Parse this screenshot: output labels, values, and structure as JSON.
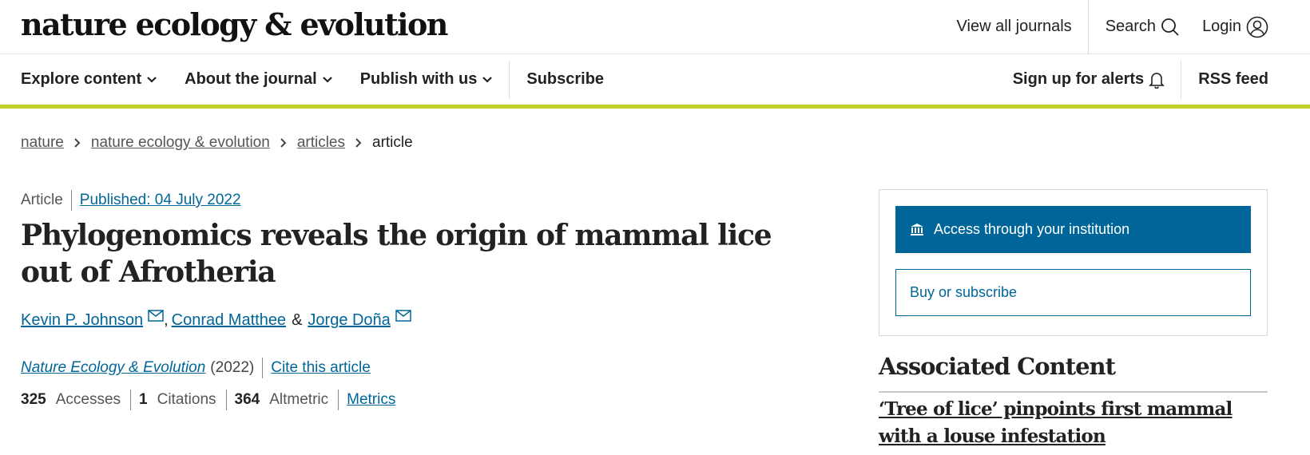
{
  "header": {
    "logo": "nature ecology & evolution",
    "view_all_journals": "View all journals",
    "search_label": "Search",
    "login_label": "Login"
  },
  "nav": {
    "explore": "Explore content",
    "about": "About the journal",
    "publish": "Publish with us",
    "subscribe": "Subscribe",
    "alerts": "Sign up for alerts",
    "rss": "RSS feed"
  },
  "breadcrumb": [
    "nature",
    "nature ecology & evolution",
    "articles",
    "article"
  ],
  "article": {
    "type": "Article",
    "published": "Published: 04 July 2022",
    "title": "Phylogenomics reveals the origin of mammal lice out of Afrotheria",
    "authors": [
      "Kevin P. Johnson",
      "Conrad Matthee",
      "Jorge Doña"
    ],
    "author_sep_comma": ",",
    "author_sep_amp": "&",
    "journal": "Nature Ecology & Evolution",
    "year": "(2022)",
    "cite": "Cite this article",
    "metrics": [
      {
        "value": "325",
        "label": "Accesses"
      },
      {
        "value": "1",
        "label": "Citations"
      },
      {
        "value": "364",
        "label": "Altmetric"
      }
    ],
    "metrics_link": "Metrics"
  },
  "access": {
    "institution": "Access through your institution",
    "buy": "Buy or subscribe"
  },
  "associated": {
    "heading": "Associated Content",
    "link": "‘Tree of lice’ pinpoints first mammal with a louse infestation"
  },
  "colors": {
    "accent_bar": "#c5d02a",
    "link_blue": "#006699",
    "text": "#222222"
  }
}
